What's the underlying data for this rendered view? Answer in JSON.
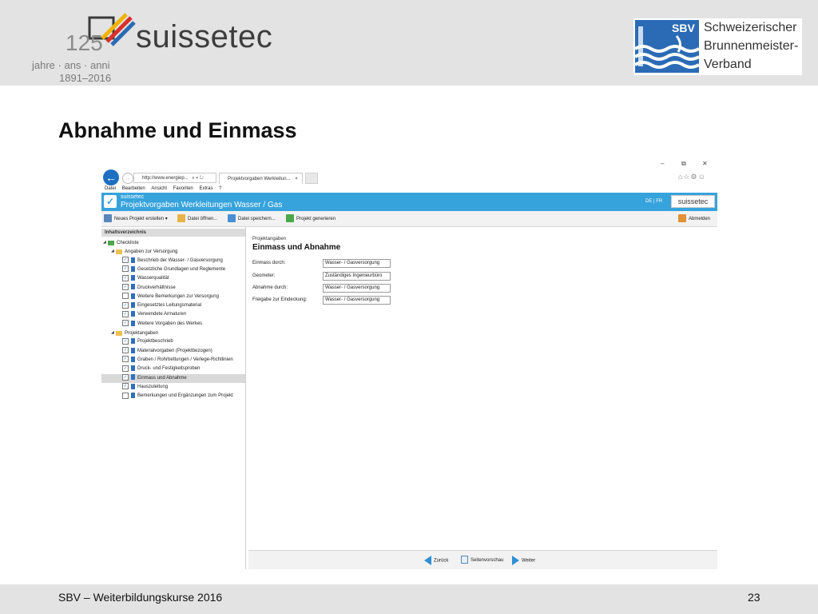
{
  "slide": {
    "title": "Abnahme und Einmass",
    "footer_left": "SBV – Weiterbildungskurse 2016",
    "page_number": "23",
    "brand_left": {
      "anniversary": "125",
      "name": "suissetec",
      "subline1": "jahre · ans · anni",
      "subline2": "1891–2016"
    },
    "brand_right": {
      "abbr": "SBV",
      "line1": "Schweizerischer",
      "line2": "Brunnenmeister-",
      "line3": "Verband"
    }
  },
  "browser": {
    "address": "http://www.energiep...",
    "address_icons": "⌕ ▾ ↻",
    "tab_label": "Projektvorgaben Werkleitun...",
    "tab_close": "×",
    "window_controls": [
      "–",
      "⧉",
      "✕"
    ],
    "right_icons": "⌂☆⚙☺",
    "back_glyph": "←",
    "forward_glyph": "→",
    "menu": [
      "Datei",
      "Bearbeiten",
      "Ansicht",
      "Favoriten",
      "Extras",
      "?"
    ]
  },
  "app": {
    "name": "suissetec",
    "title": "Projektvorgaben Werkleitungen Wasser / Gas",
    "lang": "DE | FR",
    "brand": "suissetec",
    "logo_glyph": "✓",
    "toolbar": {
      "new_project": "Neues Projekt erstellen ▾",
      "open_file": "Datei öffnen...",
      "save_file": "Datei speichern...",
      "generate": "Projekt generieren",
      "logout": "Abmelden"
    },
    "sidebar": {
      "heading": "Inhaltsverzeichnis",
      "items": [
        {
          "label": "Checkliste",
          "level": 0,
          "type": "folder",
          "check": ""
        },
        {
          "label": "Angaben zur Versorgung",
          "level": 1,
          "type": "folder",
          "check": ""
        },
        {
          "label": "Beschrieb der Wasser- / Gasversorgung",
          "level": 2,
          "type": "doc",
          "check": "✓"
        },
        {
          "label": "Gesetzliche Grundlagen und Reglemente",
          "level": 2,
          "type": "doc",
          "check": "✓"
        },
        {
          "label": "Wasserqualität",
          "level": 2,
          "type": "doc",
          "check": "✓"
        },
        {
          "label": "Druckverhältnisse",
          "level": 2,
          "type": "doc",
          "check": "✓"
        },
        {
          "label": "Weitere Bemerkungen zur Versorgung",
          "level": 2,
          "type": "doc",
          "check": ""
        },
        {
          "label": "Eingesetztes Leitungsmaterial",
          "level": 2,
          "type": "doc",
          "check": "✓"
        },
        {
          "label": "Verwendete Armaturen",
          "level": 2,
          "type": "doc",
          "check": "✓"
        },
        {
          "label": "Weitere Vorgaben des Werkes",
          "level": 2,
          "type": "doc",
          "check": "✓"
        },
        {
          "label": "Projektangaben",
          "level": 1,
          "type": "folder",
          "check": ""
        },
        {
          "label": "Projektbeschrieb",
          "level": 2,
          "type": "doc",
          "check": "✓"
        },
        {
          "label": "Materialvorgaben (Projektbezogen)",
          "level": 2,
          "type": "doc",
          "check": "✓"
        },
        {
          "label": "Graben / Rohrbettungen / Verlege-Richtlinien",
          "level": 2,
          "type": "doc",
          "check": "✓"
        },
        {
          "label": "Druck- und Festigkeitsproben",
          "level": 2,
          "type": "doc",
          "check": "✓"
        },
        {
          "label": "Einmass und Abnahme",
          "level": 2,
          "type": "doc",
          "check": "✓",
          "selected": true
        },
        {
          "label": "Hauszuleitung",
          "level": 2,
          "type": "doc",
          "check": "✓"
        },
        {
          "label": "Bemerkungen und Ergänzungen zum Projekt",
          "level": 2,
          "type": "doc",
          "check": ""
        }
      ]
    },
    "content": {
      "section": "Projektangaben",
      "title": "Einmass und Abnahme",
      "fields": [
        {
          "label": "Einmass durch:",
          "value": "Wasser- / Gasversorgung"
        },
        {
          "label": "Geometer:",
          "value": "Zuständiges Ingenieurbüro"
        },
        {
          "label": "Abnahme durch:",
          "value": "Wasser- / Gasversorgung"
        },
        {
          "label": "Freigabe zur Eindeckung:",
          "value": "Wasser- / Gasversorgung"
        }
      ]
    },
    "nav": {
      "back": "Zurück",
      "preview": "Seitenvorschau",
      "next": "Weiter"
    }
  },
  "colors": {
    "app_header": "#36a3dc",
    "accent": "#1f6fc1"
  }
}
